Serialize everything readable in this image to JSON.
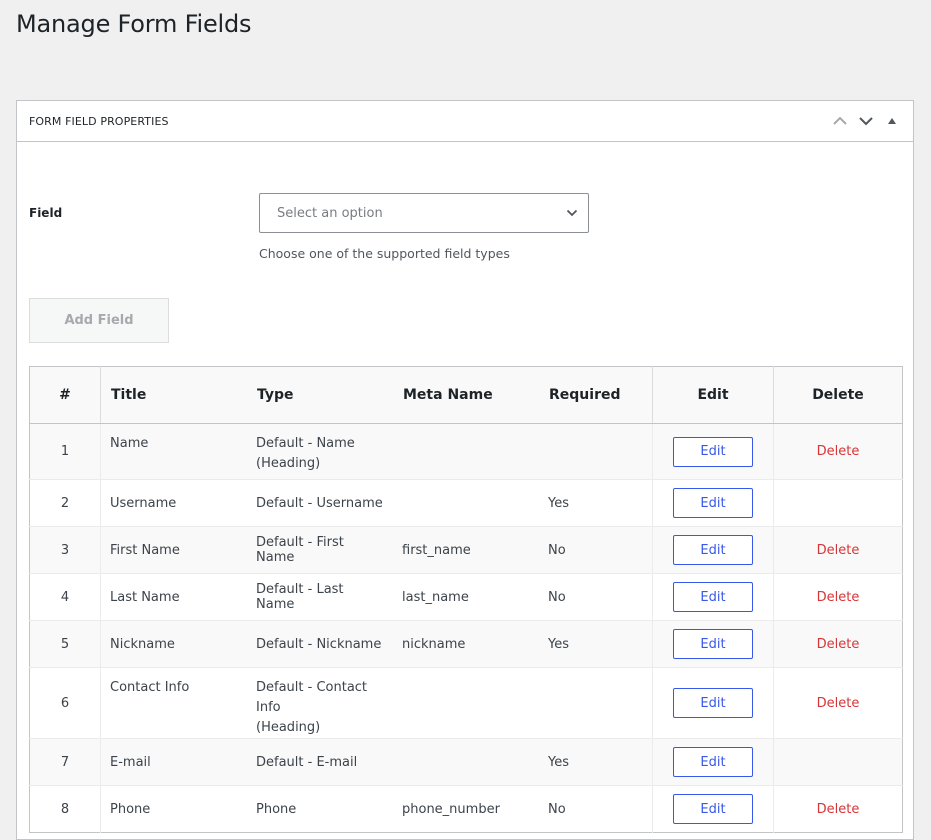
{
  "page": {
    "title": "Manage Form Fields"
  },
  "panel": {
    "title": "FORM FIELD PROPERTIES",
    "icons": [
      "chevron-up-icon",
      "chevron-down-icon",
      "triangle-up-icon"
    ]
  },
  "form": {
    "field_label": "Field",
    "select_placeholder": "Select an option",
    "help_text": "Choose one of the supported field types",
    "add_button": "Add Field"
  },
  "table": {
    "headers": {
      "num": "#",
      "title": "Title",
      "type": "Type",
      "meta": "Meta Name",
      "required": "Required",
      "edit": "Edit",
      "delete": "Delete"
    },
    "edit_label": "Edit",
    "delete_label": "Delete",
    "rows": [
      {
        "num": "1",
        "title": "Name",
        "type": "Default - Name",
        "type2": "(Heading)",
        "meta": "",
        "required": "",
        "delete": "Delete"
      },
      {
        "num": "2",
        "title": "Username",
        "type": "Default - Username",
        "type2": "",
        "meta": "",
        "required": "Yes",
        "delete": ""
      },
      {
        "num": "3",
        "title": "First Name",
        "type": "Default - First Name",
        "type2": "",
        "meta": "first_name",
        "required": "No",
        "delete": "Delete"
      },
      {
        "num": "4",
        "title": "Last Name",
        "type": "Default - Last Name",
        "type2": "",
        "meta": "last_name",
        "required": "No",
        "delete": "Delete"
      },
      {
        "num": "5",
        "title": "Nickname",
        "type": "Default - Nickname",
        "type2": "",
        "meta": "nickname",
        "required": "Yes",
        "delete": "Delete"
      },
      {
        "num": "6",
        "title": "Contact Info",
        "type": "Default - Contact Info",
        "type2": "(Heading)",
        "meta": "",
        "required": "",
        "delete": "Delete"
      },
      {
        "num": "7",
        "title": "E-mail",
        "type": "Default - E-mail",
        "type2": "",
        "meta": "",
        "required": "Yes",
        "delete": ""
      },
      {
        "num": "8",
        "title": "Phone",
        "type": "Phone",
        "type2": "",
        "meta": "phone_number",
        "required": "No",
        "delete": "Delete"
      }
    ]
  }
}
